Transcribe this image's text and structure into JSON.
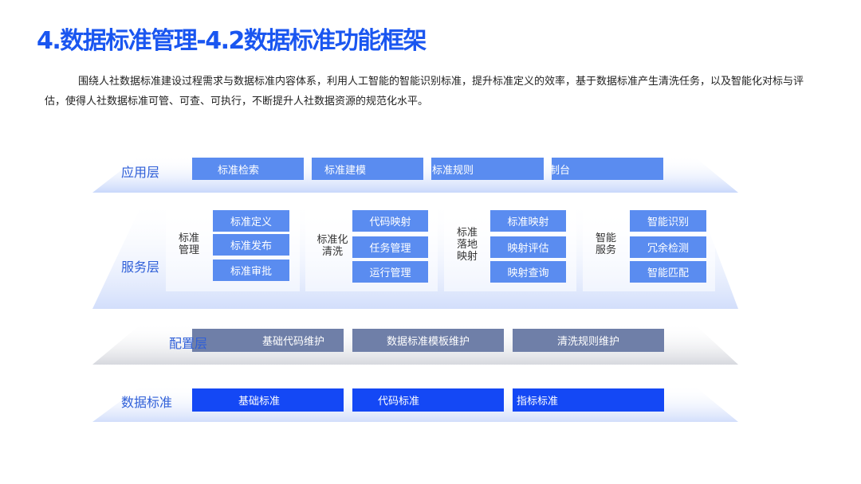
{
  "title": "4.数据标准管理-4.2数据标准功能框架",
  "intro": "围绕人社数据标准建设过程需求与数据标准内容体系，利用人工智能的智能识别标准，提升标准定义的效率，基于数据标准产生清洗任务，以及智能化对标与评估，使得人社数据标准可管、可查、可执行，不断提升人社数据资源的规范化水平。",
  "layers": {
    "app": {
      "label": "应用层",
      "items": [
        "标准检索",
        "标准建模",
        "标准规则",
        "控制台"
      ]
    },
    "service": {
      "label": "服务层",
      "groups": [
        {
          "label": [
            "标准",
            "管理"
          ],
          "items": [
            "标准定义",
            "标准发布",
            "标准审批"
          ]
        },
        {
          "label": [
            "标准化",
            "清洗"
          ],
          "items": [
            "代码映射",
            "任务管理",
            "运行管理"
          ]
        },
        {
          "label": [
            "标准",
            "落地",
            "映射"
          ],
          "items": [
            "标准映射",
            "映射评估",
            "映射查询"
          ]
        },
        {
          "label": [
            "智能",
            "服务"
          ],
          "items": [
            "智能识别",
            "冗余检测",
            "智能匹配"
          ]
        }
      ]
    },
    "config": {
      "label": "配置层",
      "items": [
        "基础代码维护",
        "数据标准模板维护",
        "清洗规则维护"
      ]
    },
    "standard": {
      "label": "数据标准",
      "items": [
        "基础标准",
        "代码标准",
        "指标标准"
      ]
    }
  },
  "colors": {
    "title": "#1a56f0",
    "app_box": "#5a8cf0",
    "service_box": "#5a8cf0",
    "config_box": "#6f7fa8",
    "standard_box": "#1448f5",
    "layer_label": "#2f5fd8"
  }
}
